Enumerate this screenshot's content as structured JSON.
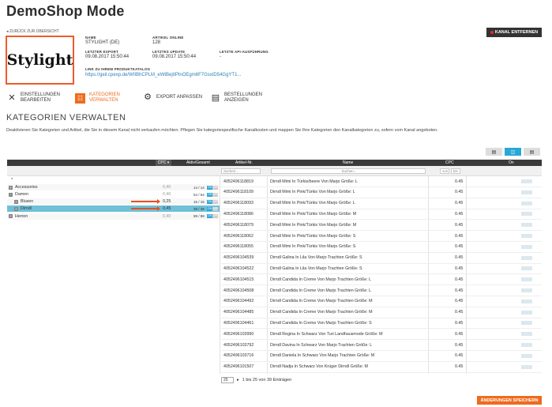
{
  "header": {
    "title": "DemoShop Mode",
    "back_link": "◂ ZURÜCK ZUR ÜBERSICHT",
    "remove_button": "KANAL ENTFERNEN"
  },
  "logo_text": "Stylight",
  "info": {
    "name_label": "NAME",
    "name_value": "STYLIGHT (DE)",
    "articles_label": "ARTIKEL ONLINE",
    "articles_value": "128",
    "export_label": "LETZTER EXPORT",
    "export_value": "09.08.2017 15:50:44",
    "update_label": "LETZTES UPDATE",
    "update_value": "09.08.2017 15:50:44",
    "api_label": "LETZTE API-AUSFÜHRUNG",
    "api_value": "-",
    "catalog_label": "LINK ZU IHREM PRODUKTKATALOG",
    "catalog_url": "https://geil.cpexp.de/WIIBhCPLM_eWtBejtIPlnOEgm6F7GsxID54GgYT1..."
  },
  "nav": [
    {
      "label_1": "EINSTELLUNGEN",
      "label_2": "BEARBEITEN",
      "icon": "tools-icon"
    },
    {
      "label_1": "KATEGORIEN",
      "label_2": "VERWALTEN",
      "icon": "categories-icon"
    },
    {
      "label_1": "EXPORT ANPASSEN",
      "label_2": "",
      "icon": "gears-icon"
    },
    {
      "label_1": "BESTELLUNGEN",
      "label_2": "ANZEIGEN",
      "icon": "orders-icon"
    }
  ],
  "section_title": "KATEGORIEN VERWALTEN",
  "description": "Deaktivieren Sie Kategorien und Artikel, die Sie in diesem Kanal nicht verkaufen möchten. Pflegen Sie kategoriespezifische Kanalkosten und mappen Sie Ihre Kategorien den Kanalkategorien zu, sofern vom Kanal angeboten.",
  "category_table": {
    "headers": {
      "cpc": "CPC ▾",
      "active": "Aktiv/Gesamt"
    },
    "rows": [
      {
        "expander": "",
        "name": "*",
        "cpc": "",
        "count": "",
        "indent": 0,
        "selected": false
      },
      {
        "expander": "+",
        "name": "Accessories",
        "cpc": "0,40",
        "count": "14 / 14",
        "indent": 0,
        "selected": false
      },
      {
        "expander": "−",
        "name": "Damen",
        "cpc": "0,40",
        "count": "54 / 54",
        "indent": 0,
        "selected": false
      },
      {
        "expander": "+",
        "name": "Blusen",
        "cpc": "0,25",
        "count": "15 / 15",
        "indent": 1,
        "selected": false
      },
      {
        "expander": "+",
        "name": "Dirndl",
        "cpc": "0,45",
        "count": "39 / 39",
        "indent": 1,
        "selected": true
      },
      {
        "expander": "+",
        "name": "Herren",
        "cpc": "0,40",
        "count": "89 / 89",
        "indent": 0,
        "selected": false
      }
    ],
    "switch_on": "ON",
    "switch_off": "OFF"
  },
  "product_table": {
    "headers": {
      "article": "Artikel-Nr.",
      "name": "Name",
      "cpc": "CPC",
      "on": "On"
    },
    "filters": {
      "article": "Suchen...",
      "name": "Suchen...",
      "von": "von",
      "bis": "bis"
    },
    "rows": [
      {
        "article": "4052496118819",
        "name": "Dirndl Mimi In Türkis/beere Von Marjo Größe: L",
        "cpc": "0.45"
      },
      {
        "article": "4052496118109",
        "name": "Dirndl Mimi In Pink/Türkis Von Marjo Größe: L",
        "cpc": "0.45"
      },
      {
        "article": "4052496118093",
        "name": "Dirndl Mimi In Pink/Türkis Von Marjo Größe: L",
        "cpc": "0.45"
      },
      {
        "article": "4052496118086",
        "name": "Dirndl Mimi In Pink/Türkis Von Marjo Größe: M",
        "cpc": "0.45"
      },
      {
        "article": "4052496118079",
        "name": "Dirndl Mimi In Pink/Türkis Von Marjo Größe: M",
        "cpc": "0.45"
      },
      {
        "article": "4052496118062",
        "name": "Dirndl Mimi In Pink/Türkis Von Marjo Größe: S",
        "cpc": "0.45"
      },
      {
        "article": "4052496118055",
        "name": "Dirndl Mimi In Pink/Türkis Von Marjo Größe: S",
        "cpc": "0.45"
      },
      {
        "article": "4052496104539",
        "name": "Dirndl Galina In Lila Von Marjo Trachten Größe: S",
        "cpc": "0.45"
      },
      {
        "article": "4052496104522",
        "name": "Dirndl Galina In Lila Von Marjo Trachten Größe: S",
        "cpc": "0.45"
      },
      {
        "article": "4052496104515",
        "name": "Dirndl Candida In Creme Von Marjo Trachten Größe: L",
        "cpc": "0.45"
      },
      {
        "article": "4052496104508",
        "name": "Dirndl Candida In Creme Von Marjo Trachten Größe: L",
        "cpc": "0.45"
      },
      {
        "article": "4052496104492",
        "name": "Dirndl Candida In Creme Von Marjo Trachten Größe: M",
        "cpc": "0.45"
      },
      {
        "article": "4052496104485",
        "name": "Dirndl Candida In Creme Von Marjo Trachten Größe: M",
        "cpc": "0.45"
      },
      {
        "article": "4052496104461",
        "name": "Dirndl Candida In Creme Von Marjo Trachten Größe: S",
        "cpc": "0.45"
      },
      {
        "article": "4052496103990",
        "name": "Dirndl Regina In Schwarz Von Turi Landhausmode Größe: M",
        "cpc": "0.45"
      },
      {
        "article": "4052496103792",
        "name": "Dirndl Davina In Schwarz Von Marjo Trachten Größe: L",
        "cpc": "0.45"
      },
      {
        "article": "4052496103716",
        "name": "Dirndl Daniela In Schwarz Von Marjo Trachten Größe: M",
        "cpc": "0.45"
      },
      {
        "article": "4052496101507",
        "name": "Dirndl Nadja In Schwarz Von Krüger Dirndl Größe: M",
        "cpc": "0.45"
      }
    ]
  },
  "pager": {
    "page_size": "25",
    "info": "1 bis 25 von 39 Einträgen"
  },
  "save_button": "ÄNDERUNGEN SPEICHERN",
  "colors": {
    "accent": "#ee6b1e",
    "selected_row": "#6fc0d8",
    "toggle": "#29a8d6"
  }
}
